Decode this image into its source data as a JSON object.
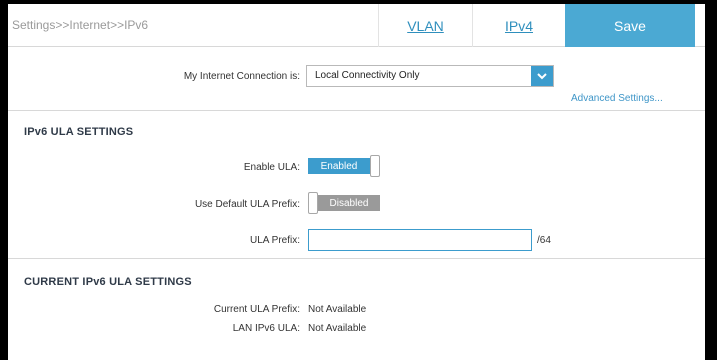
{
  "header": {
    "breadcrumb": "Settings>>Internet>>IPv6",
    "tabs": [
      {
        "label": "VLAN"
      },
      {
        "label": "IPv4"
      }
    ],
    "save_label": "Save"
  },
  "connection": {
    "label": "My Internet Connection is:",
    "selected": "Local Connectivity Only",
    "advanced_link": "Advanced Settings..."
  },
  "ula_settings": {
    "title": "IPv6 ULA SETTINGS",
    "enable_ula": {
      "label": "Enable ULA:",
      "state": "Enabled"
    },
    "use_default_prefix": {
      "label": "Use Default ULA Prefix:",
      "state": "Disabled"
    },
    "ula_prefix": {
      "label": "ULA Prefix:",
      "value": "",
      "suffix": "/64"
    }
  },
  "current_settings": {
    "title": "CURRENT IPv6 ULA SETTINGS",
    "current_ula_prefix": {
      "label": "Current ULA Prefix:",
      "value": "Not Available"
    },
    "lan_ipv6_ula": {
      "label": "LAN IPv6 ULA:",
      "value": "Not Available"
    }
  },
  "colors": {
    "accent": "#3c9ccd",
    "save_button": "#4ba9d3",
    "disabled_toggle": "#9a9a9a",
    "link": "#2f8fbd"
  }
}
